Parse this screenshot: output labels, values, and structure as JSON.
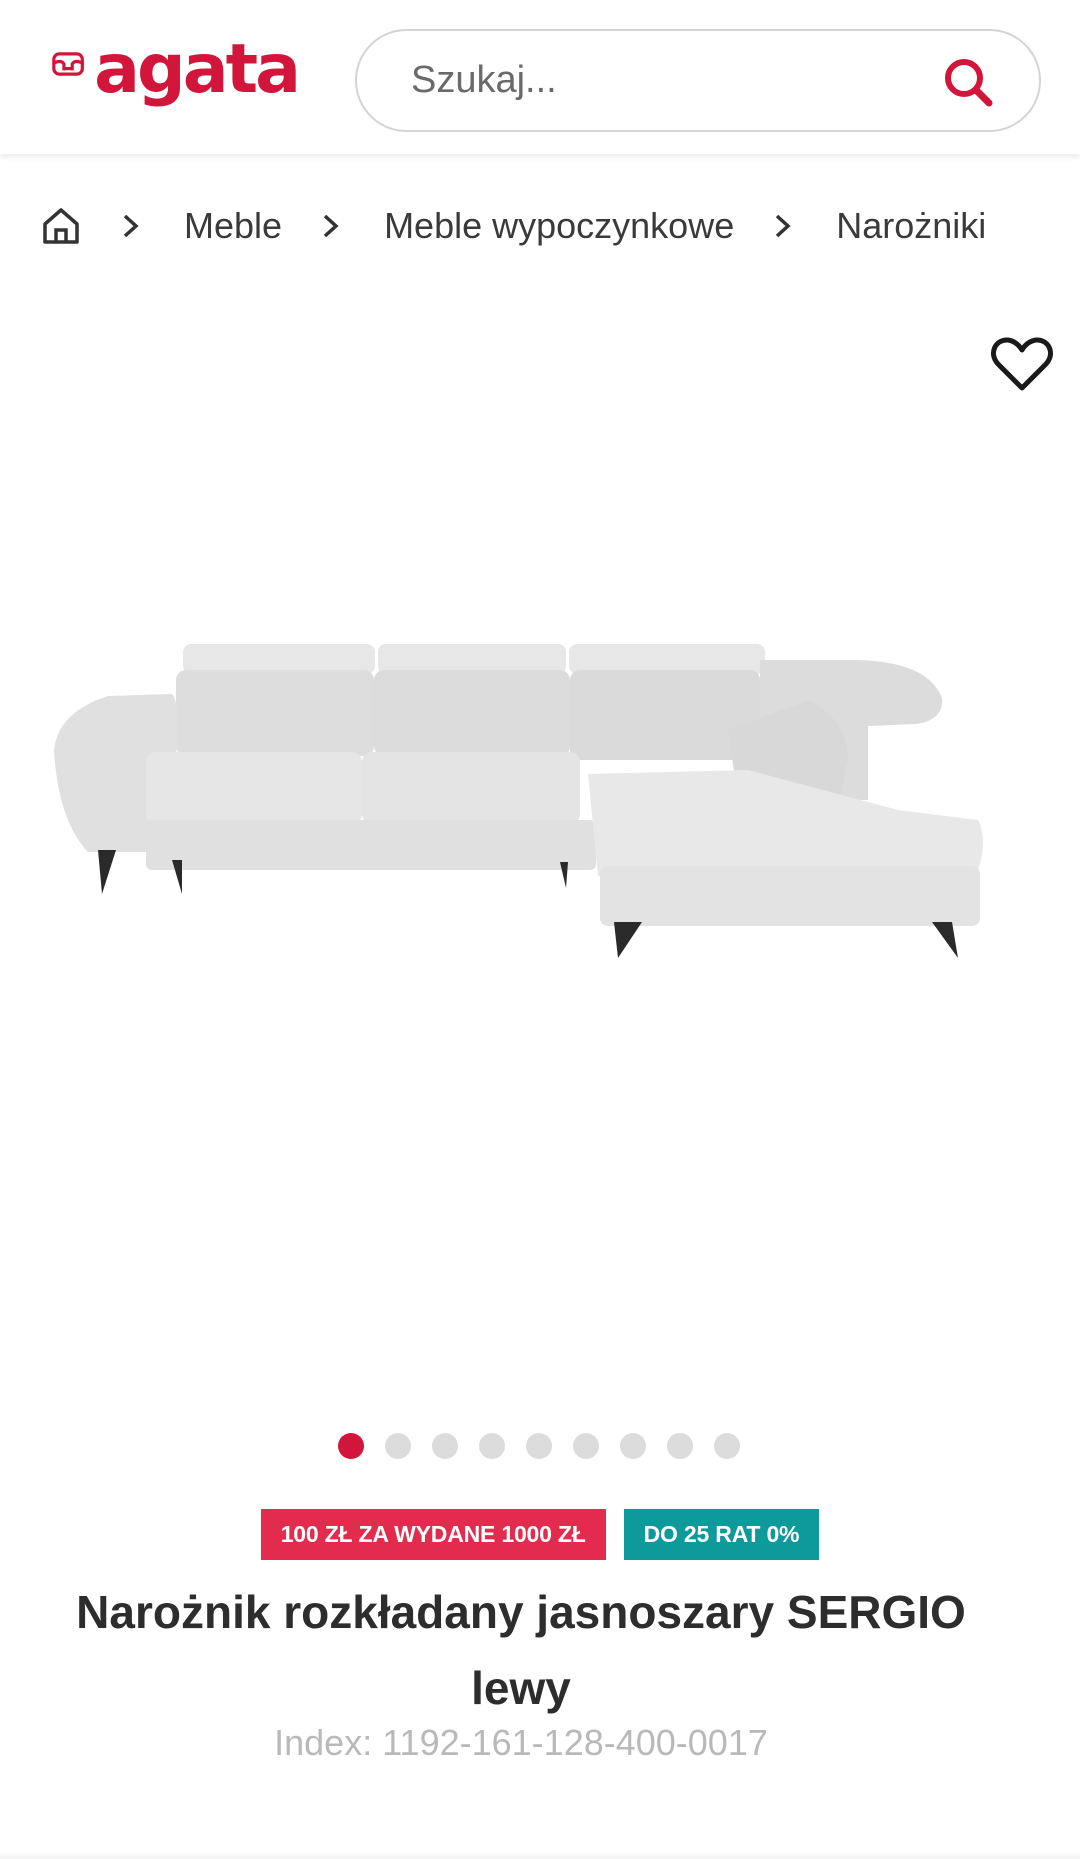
{
  "header": {
    "logo_text": "agata",
    "search_placeholder": "Szukaj...",
    "search_icon": "search-icon",
    "brand_color": "#d2163b"
  },
  "breadcrumb": {
    "home_icon": "home-icon",
    "items": [
      "Meble",
      "Meble wypoczynkowe",
      "Narożniki"
    ]
  },
  "gallery": {
    "favorite_icon": "heart-outline-icon",
    "image_subject": "corner-sofa-light-grey",
    "total_images": 9,
    "active_index": 0
  },
  "product": {
    "badges": [
      {
        "label": "100 ZŁ ZA WYDANE 1000 ZŁ",
        "color": "#e32b4d"
      },
      {
        "label": "DO 25 RAT 0%",
        "color": "#0e9a9a"
      }
    ],
    "title": "Narożnik rozkładany jasnoszary SERGIO lewy",
    "index": "Index: 1192-161-128-400-0017"
  }
}
